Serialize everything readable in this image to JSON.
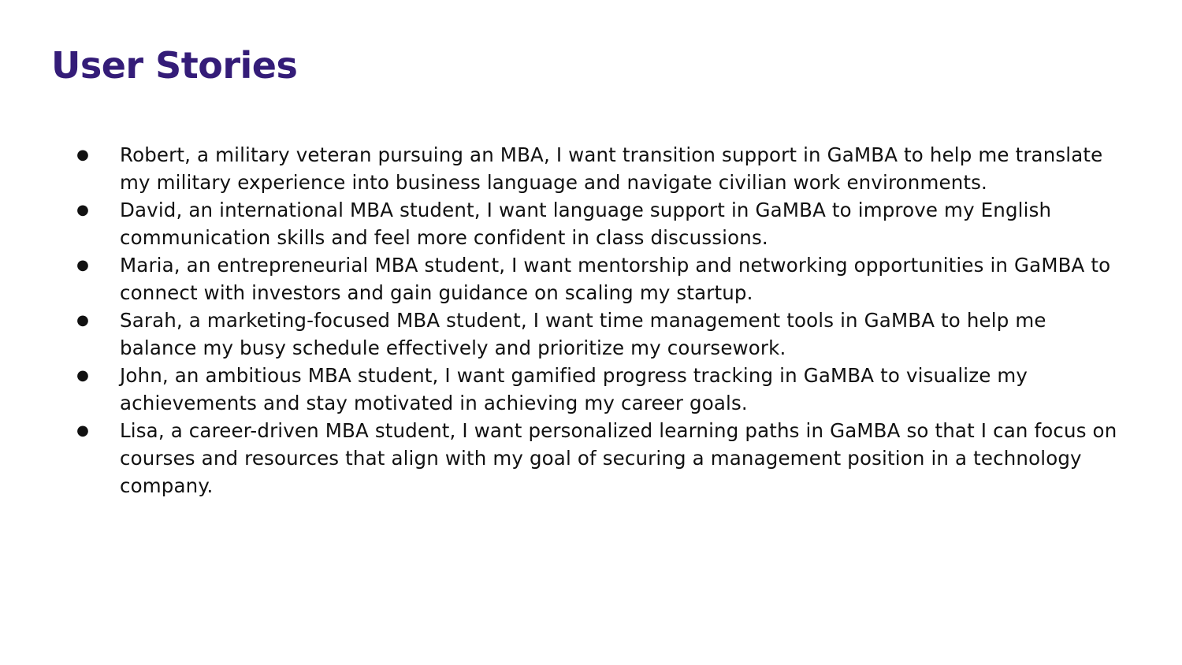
{
  "slide": {
    "title": "User Stories",
    "title_color": "#341c78",
    "bullet_glyph": "●",
    "stories": [
      "Robert, a military veteran pursuing an MBA, I want transition support in GaMBA to help me translate my military experience into business language and navigate civilian work environments.",
      "David, an international MBA student, I want language support in GaMBA to improve my English communication skills and feel more confident in class discussions.",
      "Maria, an entrepreneurial MBA student, I want mentorship and networking opportunities in GaMBA to connect with investors and gain guidance on scaling my startup.",
      "Sarah, a marketing-focused MBA student, I want time management tools in GaMBA to help me balance my busy schedule effectively and prioritize my coursework.",
      "John, an ambitious MBA student, I want gamified progress tracking in GaMBA to visualize my achievements and stay motivated in achieving my career goals.",
      "Lisa, a career-driven MBA student, I want personalized learning paths in GaMBA so that I can focus on courses and resources that align with my goal of securing a management position in a technology company."
    ]
  }
}
